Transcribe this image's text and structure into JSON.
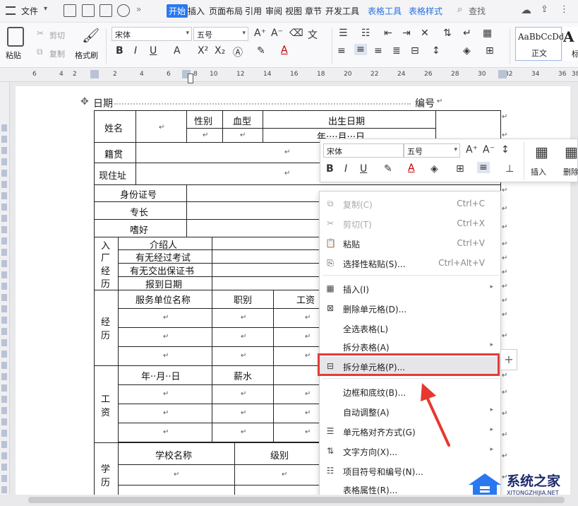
{
  "menubar": {
    "file": "文件",
    "tabs": [
      "开始",
      "插入",
      "页面布局",
      "引用",
      "审阅",
      "视图",
      "章节",
      "开发工具",
      "表格工具",
      "表格样式"
    ],
    "search": "查找"
  },
  "ribbon": {
    "paste": "粘贴",
    "cut": "剪切",
    "copy": "复制",
    "format_painter": "格式刷",
    "font": "宋体",
    "size": "五号",
    "style_sample": "AaBbCcDd",
    "style_name": "正文",
    "style_next_sample": "A",
    "style_next_name": "标"
  },
  "ruler": {
    "h_numbers": [
      "6",
      "4",
      "2",
      "2",
      "4",
      "6",
      "8",
      "10",
      "12",
      "14",
      "16",
      "18",
      "20",
      "22",
      "24",
      "26",
      "28",
      "30",
      "32",
      "34",
      "36",
      "38"
    ],
    "v_numbers": [
      "2",
      "2",
      "4",
      "6",
      "8",
      "10",
      "12",
      "14",
      "16",
      "18",
      "20",
      "22",
      "24",
      "26",
      "28"
    ]
  },
  "document": {
    "date_label": "日期",
    "number_label": "编号",
    "name": "姓名",
    "gender": "性别",
    "blood": "血型",
    "birthday": "出生日期",
    "birthday_fmt": "年····月···日",
    "native": "籍贯",
    "address": "现住址",
    "id_no": "身份证号",
    "specialty": "专长",
    "hobby": "嗜好",
    "entry_chars": [
      "入",
      "厂",
      "经",
      "历"
    ],
    "referrer": "介绍人",
    "exam": "有无经过考试",
    "guarantee": "有无交出保证书",
    "report_date": "报到日期",
    "exp_chars": [
      "经",
      "历"
    ],
    "employer": "服务单位名称",
    "position": "职别",
    "wage_short": "工资",
    "wage_chars": [
      "工",
      "资"
    ],
    "date_fmt": "年··月··日",
    "salary": "薪水",
    "edu_chars": [
      "学",
      "历"
    ],
    "school": "学校名称",
    "level": "级别",
    "para_mark": "↵"
  },
  "mini_toolbar": {
    "font": "宋体",
    "size": "五号",
    "insert": "插入",
    "delete": "删除"
  },
  "context_menu": {
    "items": [
      {
        "label": "复制(C)",
        "shortcut": "Ctrl+C"
      },
      {
        "label": "剪切(T)",
        "shortcut": "Ctrl+X"
      },
      {
        "label": "粘贴",
        "shortcut": "Ctrl+V"
      },
      {
        "label": "选择性粘贴(S)...",
        "shortcut": "Ctrl+Alt+V"
      },
      {
        "label": "插入(I)"
      },
      {
        "label": "删除单元格(D)..."
      },
      {
        "label": "全选表格(L)"
      },
      {
        "label": "拆分表格(A)"
      },
      {
        "label": "拆分单元格(P)..."
      },
      {
        "label": "边框和底纹(B)..."
      },
      {
        "label": "自动调整(A)"
      },
      {
        "label": "单元格对齐方式(G)"
      },
      {
        "label": "文字方向(X)..."
      },
      {
        "label": "项目符号和编号(N)..."
      },
      {
        "label": "表格属性(R)..."
      }
    ]
  },
  "watermark": {
    "name": "系统之家",
    "url": "XITONGZHIJIA.NET"
  },
  "colors": {
    "accent": "#2a78f0",
    "highlight": "#e23b3b",
    "arrow": "#e8372f"
  }
}
